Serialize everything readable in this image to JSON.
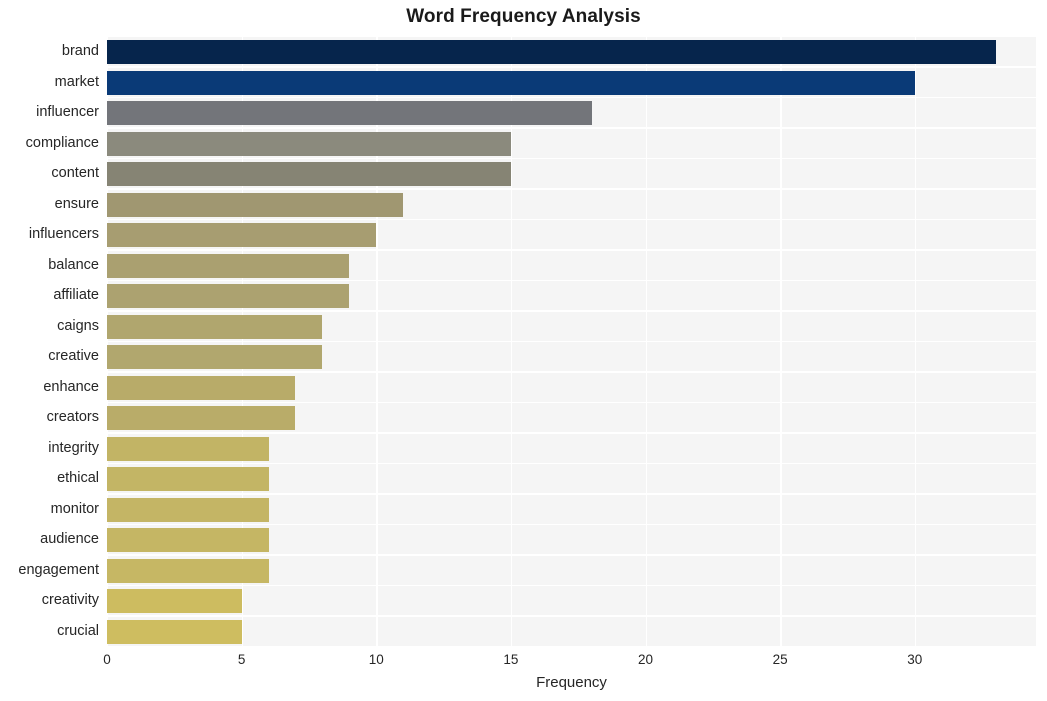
{
  "chart_data": {
    "type": "bar",
    "orientation": "horizontal",
    "title": "Word Frequency Analysis",
    "xlabel": "Frequency",
    "ylabel": "",
    "categories": [
      "brand",
      "market",
      "influencer",
      "compliance",
      "content",
      "ensure",
      "influencers",
      "balance",
      "affiliate",
      "caigns",
      "creative",
      "enhance",
      "creators",
      "integrity",
      "ethical",
      "monitor",
      "audience",
      "engagement",
      "creativity",
      "crucial"
    ],
    "values": [
      33,
      30,
      18,
      15,
      15,
      11,
      10,
      9,
      9,
      8,
      8,
      7,
      7,
      6,
      6,
      6,
      6,
      6,
      5,
      5
    ],
    "bar_colors": [
      "#06254c",
      "#0a3a77",
      "#73757a",
      "#8b8a7d",
      "#868474",
      "#a09771",
      "#a79d71",
      "#aaa070",
      "#aca270",
      "#b0a66e",
      "#b1a76e",
      "#b8ab69",
      "#b9ac69",
      "#c2b465",
      "#c3b565",
      "#c4b565",
      "#c5b664",
      "#c6b764",
      "#cdbc60",
      "#cebd60"
    ],
    "xlim": [
      0,
      34.5
    ],
    "xticks": [
      0,
      5,
      10,
      15,
      20,
      25,
      30
    ],
    "xticklabels": [
      "0",
      "5",
      "10",
      "15",
      "20",
      "25",
      "30"
    ],
    "grid": true,
    "grid_color": "#ffffff",
    "plot_background": "#f5f5f5",
    "figure_background": "#ffffff",
    "legend": null
  }
}
